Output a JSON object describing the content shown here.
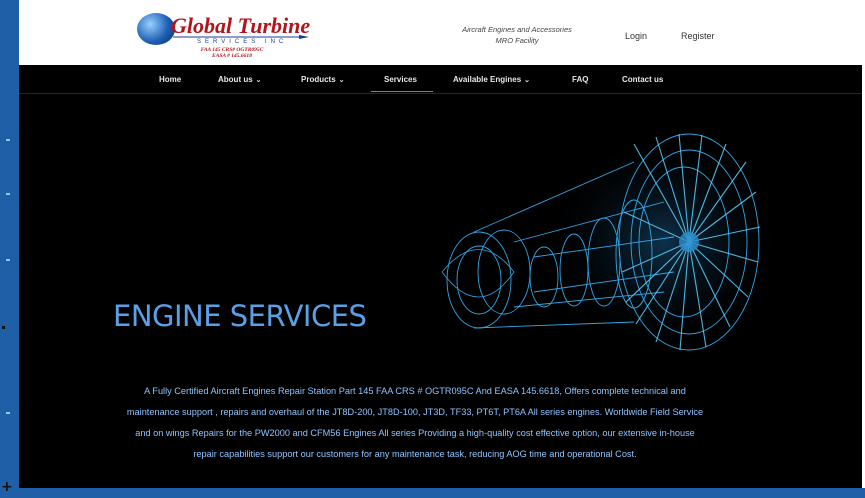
{
  "logo": {
    "brand": "Global Turbine",
    "subtitle": "SERVICES INC",
    "cert_line1": "FAA 145 CRS# OGTR095C",
    "cert_line2": "EASA # 145.6618"
  },
  "header": {
    "tagline_line1": "Aircraft Engines and Accessories",
    "tagline_line2": "MRO Facility",
    "login_label": "Login",
    "register_label": "Register"
  },
  "nav": {
    "items": [
      {
        "label": "Home",
        "has_dropdown": false
      },
      {
        "label": "About us",
        "has_dropdown": true
      },
      {
        "label": "Products",
        "has_dropdown": true
      },
      {
        "label": "Services",
        "has_dropdown": false,
        "active": true
      },
      {
        "label": "Available Engines",
        "has_dropdown": true
      },
      {
        "label": "FAQ",
        "has_dropdown": false
      },
      {
        "label": "Contact us",
        "has_dropdown": false
      }
    ],
    "dropdown_glyph": "⌄"
  },
  "hero": {
    "title": "ENGINE SERVICES",
    "description_lines": [
      "A Fully Certified Aircraft Engines Repair Station Part 145 FAA CRS # OGTR095C And EASA 145.6618, Offers complete technical and",
      "maintenance support , repairs and overhaul of the JT8D-200, JT8D-100, JT3D, TF33, PT6T, PT6A All series engines. Worldwide Field Service",
      "and on wings Repairs for the PW2000 and CFM56 Engines All series Providing a high-quality cost effective option, our extensive in-house",
      "repair capabilities support our customers for any maintenance task, reducing AOG time and operational Cost."
    ]
  },
  "colors": {
    "brand_red": "#b2141b",
    "brand_blue": "#1c3c8c",
    "hero_title": "#5aa0e6",
    "hero_text": "#8ec5ff",
    "nav_active_underline": "#4a8fd0",
    "window_frame": "#1f5fa8"
  },
  "icons": {
    "dropdown": "chevron-down-icon",
    "logo_globe": "globe-icon",
    "hero_image": "turbine-engine-illustration"
  }
}
